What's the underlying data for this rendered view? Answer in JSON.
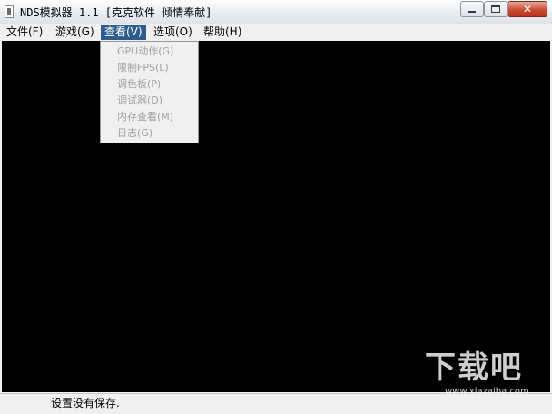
{
  "window": {
    "title": "NDS模拟器 1.1 [克克软件 倾情奉献]",
    "controls": {
      "minimize": "minimize",
      "maximize": "maximize",
      "close": "x"
    }
  },
  "menubar": {
    "items": [
      {
        "label": "文件(F)"
      },
      {
        "label": "游戏(G)"
      },
      {
        "label": "查看(V)",
        "active": true
      },
      {
        "label": "选项(O)"
      },
      {
        "label": "帮助(H)"
      }
    ]
  },
  "dropdown": {
    "items": [
      {
        "label": "GPU动作(G)",
        "enabled": false
      },
      {
        "label": "限制FPS(L)",
        "enabled": false
      },
      {
        "label": "调色板(P)",
        "enabled": false
      },
      {
        "label": "调试器(D)",
        "enabled": false
      },
      {
        "label": "内存查看(M)",
        "enabled": false
      },
      {
        "label": "日志(G)",
        "enabled": false
      }
    ]
  },
  "statusbar": {
    "text": "设置没有保存."
  },
  "watermark": {
    "main": "下载吧",
    "sub": "www.xiazaiba.com"
  },
  "colors": {
    "menu_active_bg": "#2d5b8e",
    "display_bg": "#000000",
    "disabled_text": "#a0a0a0"
  }
}
